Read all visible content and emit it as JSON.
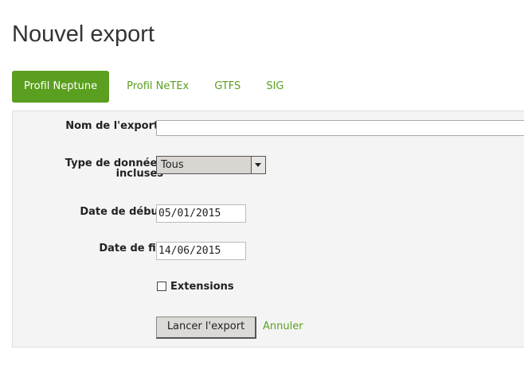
{
  "page": {
    "title": "Nouvel export"
  },
  "tabs": [
    {
      "label": "Profil Neptune",
      "active": true
    },
    {
      "label": "Profil NeTEx",
      "active": false
    },
    {
      "label": "GTFS",
      "active": false
    },
    {
      "label": "SIG",
      "active": false
    }
  ],
  "form": {
    "name_label": "Nom de l'export",
    "name_required_mark": "*",
    "name_value": "",
    "type_label_line1": "Type de données",
    "type_label_line2": "incluses",
    "type_value": "Tous",
    "start_label": "Date de début",
    "start_value": "05/01/2015",
    "end_label": "Date de fin",
    "end_value": "14/06/2015",
    "extensions_label": "Extensions",
    "extensions_checked": false,
    "submit_label": "Lancer l'export",
    "cancel_label": "Annuler"
  },
  "colors": {
    "accent": "#5a9f1f",
    "panel_bg": "#f4f4f4"
  },
  "icons": {
    "name_field_icon": "keypass-icon",
    "select_arrow": "chevron-down-icon"
  }
}
